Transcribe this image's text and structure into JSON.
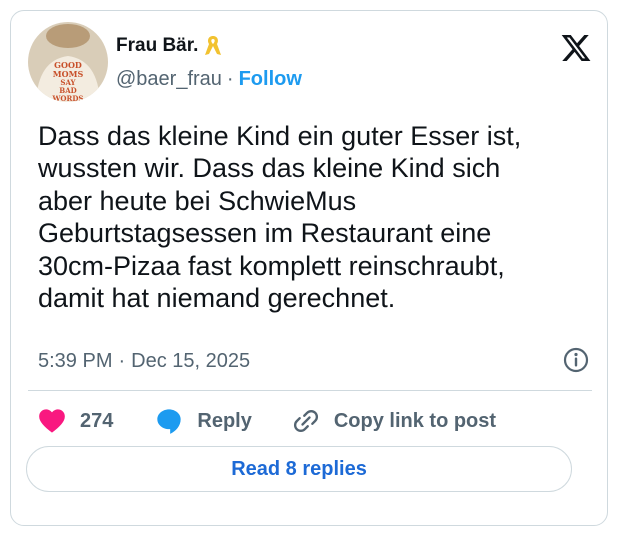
{
  "author": {
    "display_name": "Frau Bär.",
    "handle": "@baer_frau",
    "separator": "·",
    "follow_label": "Follow",
    "avatar_shirt_text": "GOOD MOMS SAY BAD WORDS",
    "badge_icon": "yellow-ribbon-icon"
  },
  "platform_icon": "x-logo-icon",
  "tweet": {
    "text": "Dass das kleine Kind ein guter Esser ist,\nwussten wir. Dass das kleine Kind sich\naber heute bei SchwieMus\nGeburtstagsessen im Restaurant eine\n30cm-Pizaa fast komplett reinschraubt,\ndamit hat niemand gerechnet.",
    "time": "5:39 PM",
    "separator": "·",
    "date": "Dec 15, 2025"
  },
  "actions": {
    "like_count": "274",
    "reply_label": "Reply",
    "copy_link_label": "Copy link to post"
  },
  "read_replies_label": "Read 8 replies",
  "colors": {
    "accent": "#1d9bf0",
    "heart": "#f91880",
    "muted_text": "#536471",
    "border": "#cfd9de"
  }
}
